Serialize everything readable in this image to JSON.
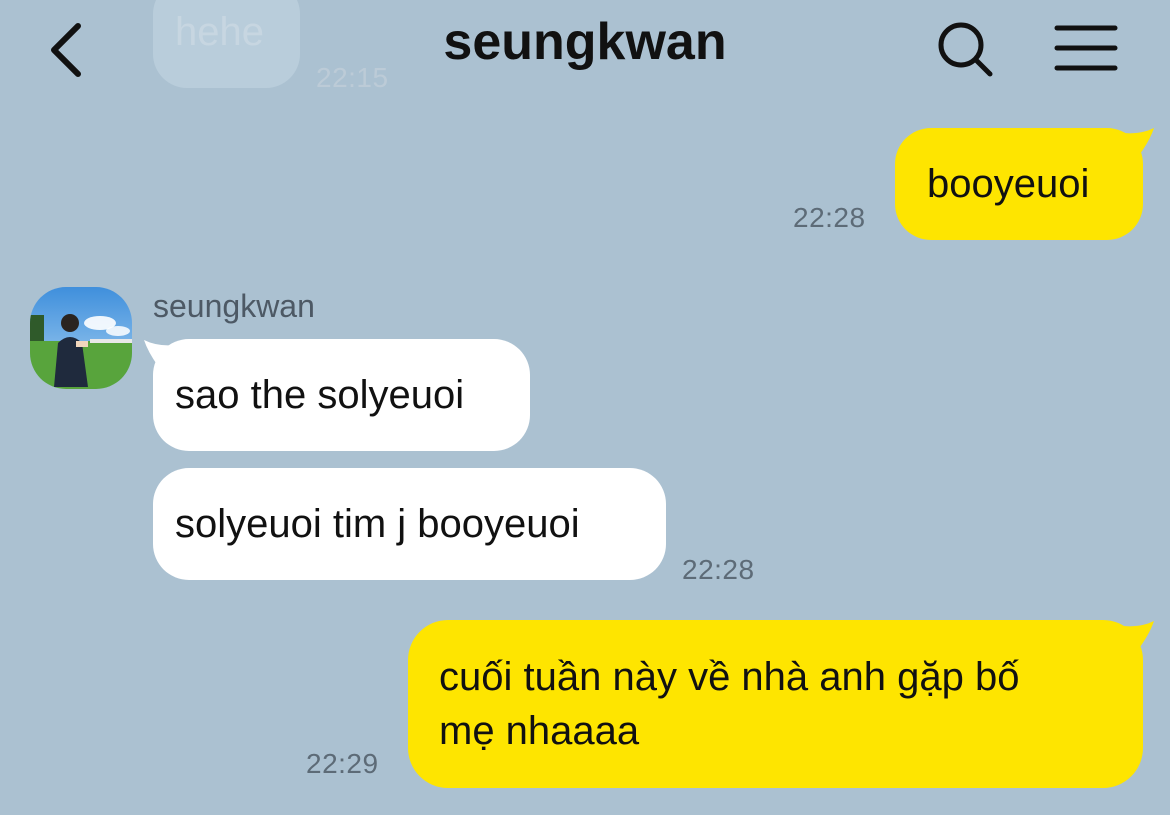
{
  "header": {
    "title": "seungkwan",
    "back_icon": "chevron-left-icon",
    "search_icon": "search-icon",
    "menu_icon": "menu-icon"
  },
  "faded_message": {
    "text": "hehe",
    "time": "22:15"
  },
  "messages": [
    {
      "from": "me",
      "text": "booyeuoi",
      "time": "22:28"
    },
    {
      "from": "seungkwan",
      "sender": "seungkwan",
      "text": "sao the solyeuoi"
    },
    {
      "from": "seungkwan",
      "text": "solyeuoi tim j booyeuoi",
      "time": "22:28"
    },
    {
      "from": "me",
      "lines": [
        "cuối tuần này về nhà anh gặp bố",
        "mẹ nhaaaa"
      ],
      "time": "22:29"
    }
  ],
  "colors": {
    "background": "#abc1d1",
    "my_bubble": "#fee500",
    "their_bubble": "#ffffff",
    "timestamp": "#5d6b77"
  }
}
